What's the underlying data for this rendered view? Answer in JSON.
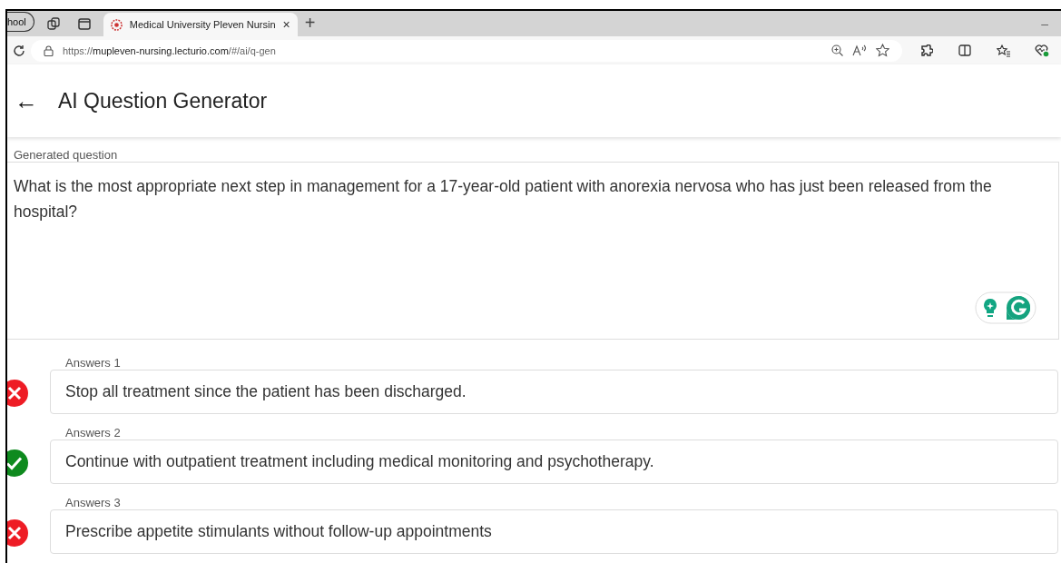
{
  "browser": {
    "tab_group": "hool",
    "tabs": [
      {
        "title": "Medical University Pleven Nursin",
        "selected": true,
        "close": "×"
      }
    ],
    "new_tab": "+",
    "minimize": "–",
    "url_prefix": "https://",
    "url_host": "mupleven-nursing.lecturio.com",
    "url_path": "/#/ai/q-gen"
  },
  "header": {
    "back": "←",
    "title": "AI Question Generator"
  },
  "question": {
    "label": "Generated question",
    "text": "What is the most appropriate next step in management for a 17-year-old patient with anorexia nervosa who has just been released from the hospital?"
  },
  "answers": [
    {
      "label": "Answers 1",
      "text": "Stop all treatment since the patient has been discharged.",
      "correct": false
    },
    {
      "label": "Answers 2",
      "text": "Continue with outpatient treatment including medical monitoring and psychotherapy.",
      "correct": true
    },
    {
      "label": "Answers 3",
      "text": "Prescribe appetite stimulants without follow-up appointments",
      "correct": false
    }
  ]
}
